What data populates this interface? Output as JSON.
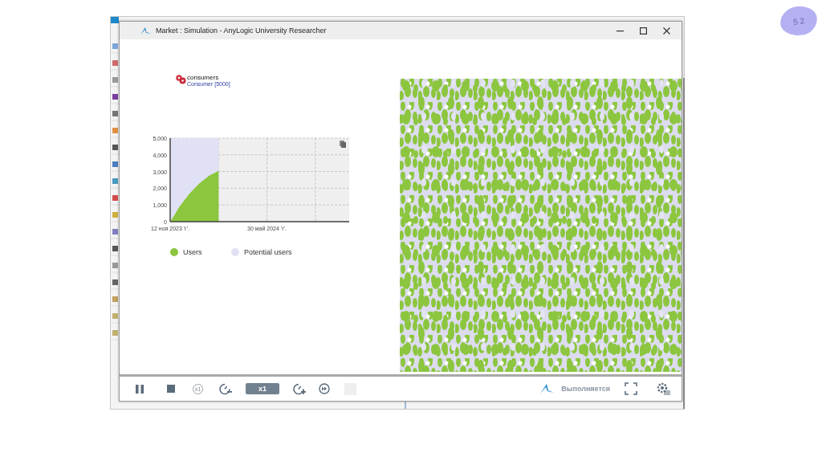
{
  "slide": {
    "number": "5 2"
  },
  "window": {
    "title": "Market : Simulation - AnyLogic University Researcher"
  },
  "population": {
    "name": "consumers",
    "type_label": "Consumer [5000]"
  },
  "chart": {
    "chart_data": {
      "type": "area",
      "stacked": true,
      "grid": true,
      "categories": [
        "12 ноя 2023 'г'.",
        null,
        null,
        null,
        null,
        null,
        null,
        null,
        null,
        null,
        "30 май 2024 'г'.",
        null,
        null,
        null,
        null,
        null,
        null,
        null,
        null
      ],
      "ylim": [
        0,
        5000
      ],
      "yticks": [
        {
          "value": 0,
          "label": "0"
        },
        {
          "value": 1000,
          "label": "1,000"
        },
        {
          "value": 2000,
          "label": "2,000"
        },
        {
          "value": 3000,
          "label": "3,000"
        },
        {
          "value": 4000,
          "label": "4,000"
        },
        {
          "value": 5000,
          "label": "5,000"
        }
      ],
      "series": [
        {
          "name": "Users",
          "color": "#8cc63f",
          "values": [
            0,
            950,
            1700,
            2300,
            2750,
            3050,
            null,
            null,
            null,
            null,
            null,
            null,
            null,
            null,
            null,
            null,
            null,
            null,
            null
          ]
        },
        {
          "name": "Potential users",
          "color": "#e1e1f6",
          "values": [
            5000,
            4050,
            3300,
            2700,
            2250,
            1950,
            null,
            null,
            null,
            null,
            null,
            null,
            null,
            null,
            null,
            null,
            null,
            null,
            null
          ]
        }
      ]
    }
  },
  "toolbar": {
    "reset_label": "x1",
    "speed": "x1",
    "status": "Выполняется"
  }
}
